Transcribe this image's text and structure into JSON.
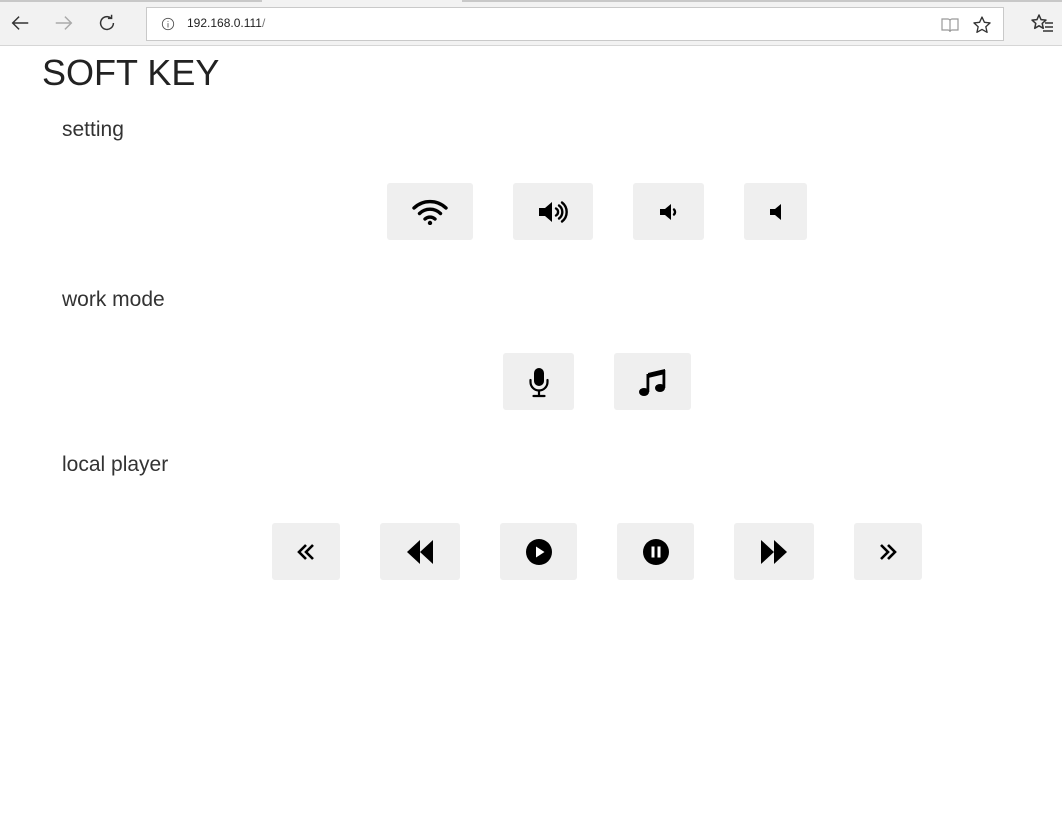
{
  "browser": {
    "url_host": "192.168.0.111",
    "url_path": "/"
  },
  "page": {
    "title": "SOFT KEY",
    "sections": [
      {
        "label": "setting",
        "buttons": [
          "wifi-icon",
          "volume-up-icon",
          "volume-down-icon",
          "volume-off-icon"
        ]
      },
      {
        "label": "work mode",
        "buttons": [
          "microphone-icon",
          "music-note-icon"
        ]
      },
      {
        "label": "local player",
        "buttons": [
          "double-angle-left-icon",
          "rewind-icon",
          "play-icon",
          "pause-icon",
          "fast-forward-icon",
          "double-angle-right-icon"
        ]
      }
    ]
  },
  "colors": {
    "button_bg": "#efefef",
    "icon": "#000000"
  }
}
